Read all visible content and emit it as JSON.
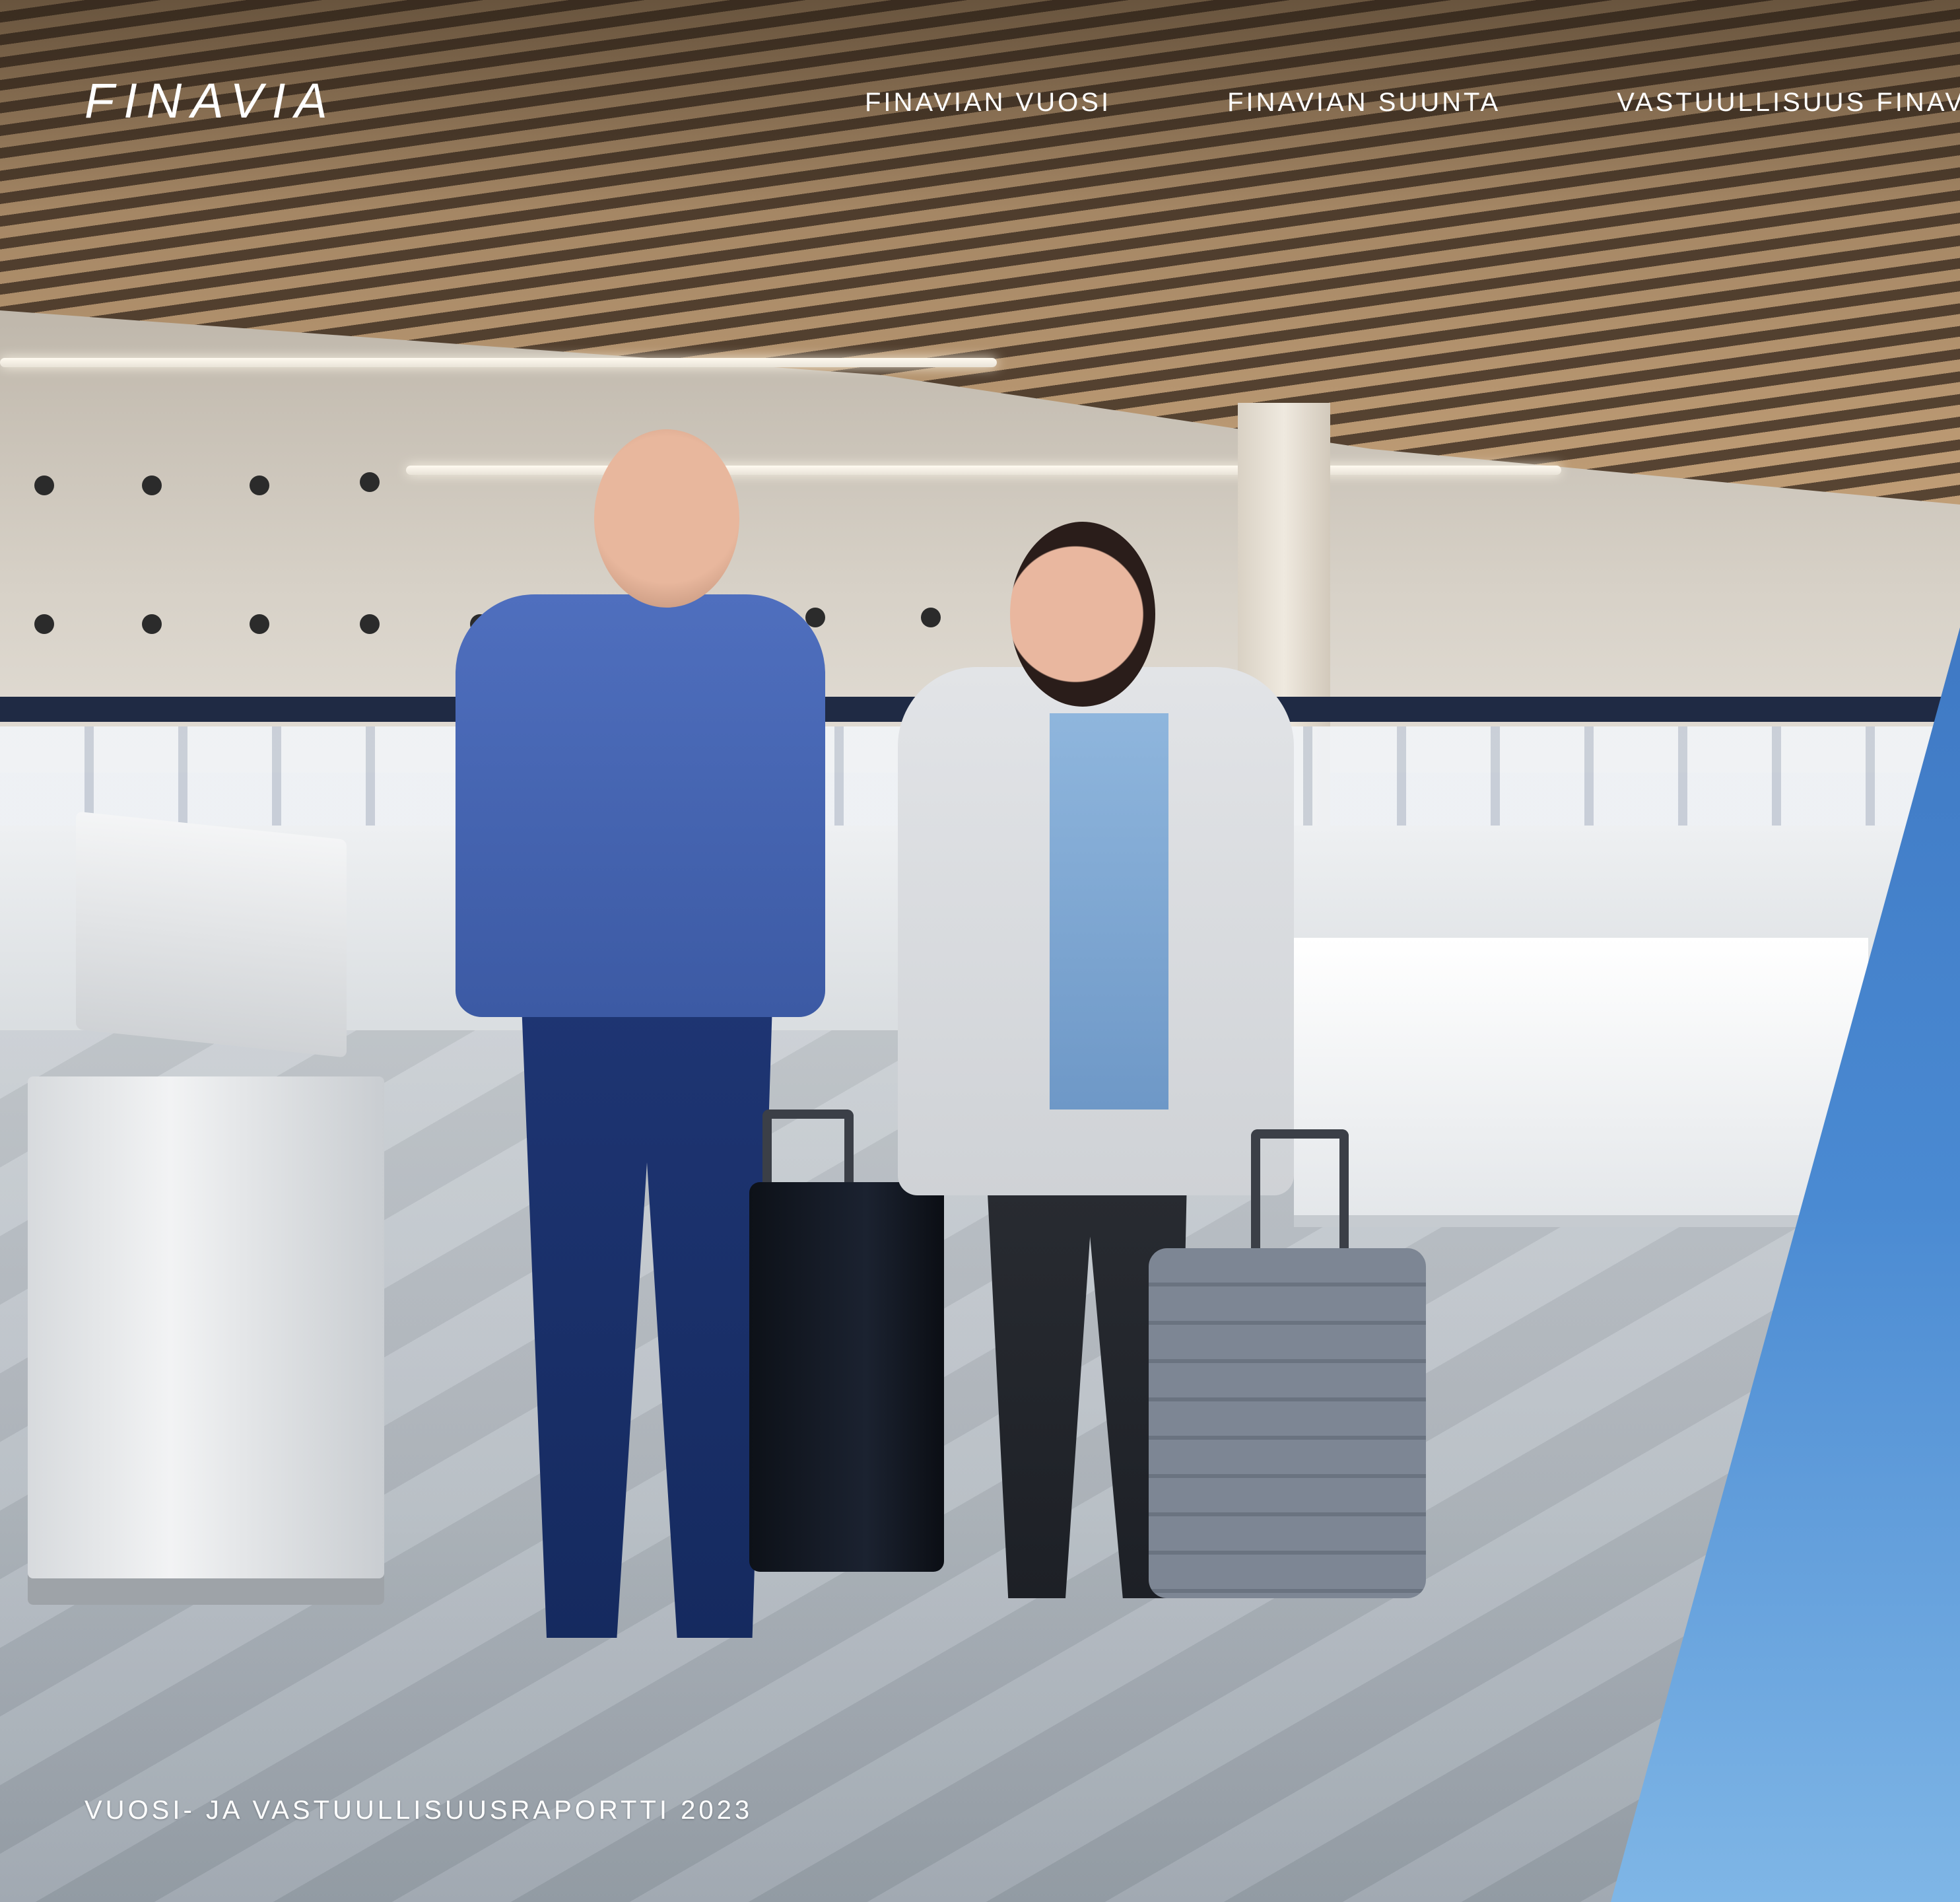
{
  "brand": {
    "logo_text": "FINAVIA"
  },
  "nav": {
    "items": [
      {
        "label": "FINAVIAN VUOSI"
      },
      {
        "label": "FINAVIAN SUUNTA"
      },
      {
        "label": "VASTUULLISUUS FINAVIA"
      }
    ]
  },
  "report": {
    "title": "VUOSI- JA VASTUULLISUUSRAPORTTI 2023"
  },
  "colors": {
    "accent_blue": "#4a8ad2",
    "text": "#ffffff"
  }
}
